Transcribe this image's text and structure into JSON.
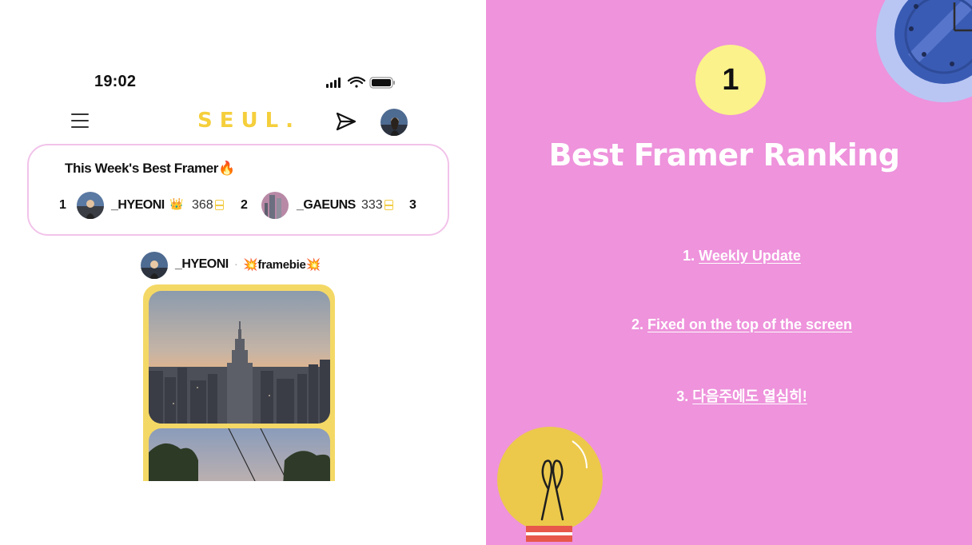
{
  "status_bar": {
    "time": "19:02"
  },
  "header": {
    "logo": "SEUL."
  },
  "best_framer": {
    "title": "This Week's Best Framer🔥",
    "entries": [
      {
        "rank": "1",
        "name": "_HYEONI",
        "crown": "👑",
        "score": "368"
      },
      {
        "rank": "2",
        "name": "_GAEUNS",
        "score": "333"
      },
      {
        "rank": "3"
      }
    ]
  },
  "post": {
    "user": "_HYEONI",
    "separator": "·",
    "badge": "framebie",
    "badge_sparkle": "💥"
  },
  "slide": {
    "badge_number": "1",
    "title": "Best Framer Ranking",
    "items": [
      {
        "num": "1.",
        "text": "Weekly Update"
      },
      {
        "num": "2.",
        "text": "Fixed on the top of the screen"
      },
      {
        "num": "3.",
        "text": "다음주에도 열심히!"
      }
    ]
  },
  "colors": {
    "right_bg": "#ee93dc",
    "logo_yellow": "#f5cf3c",
    "badge_yellow": "#fbf28b",
    "box_border": "#f2c3ea",
    "frame_yellow": "#f4d866"
  }
}
